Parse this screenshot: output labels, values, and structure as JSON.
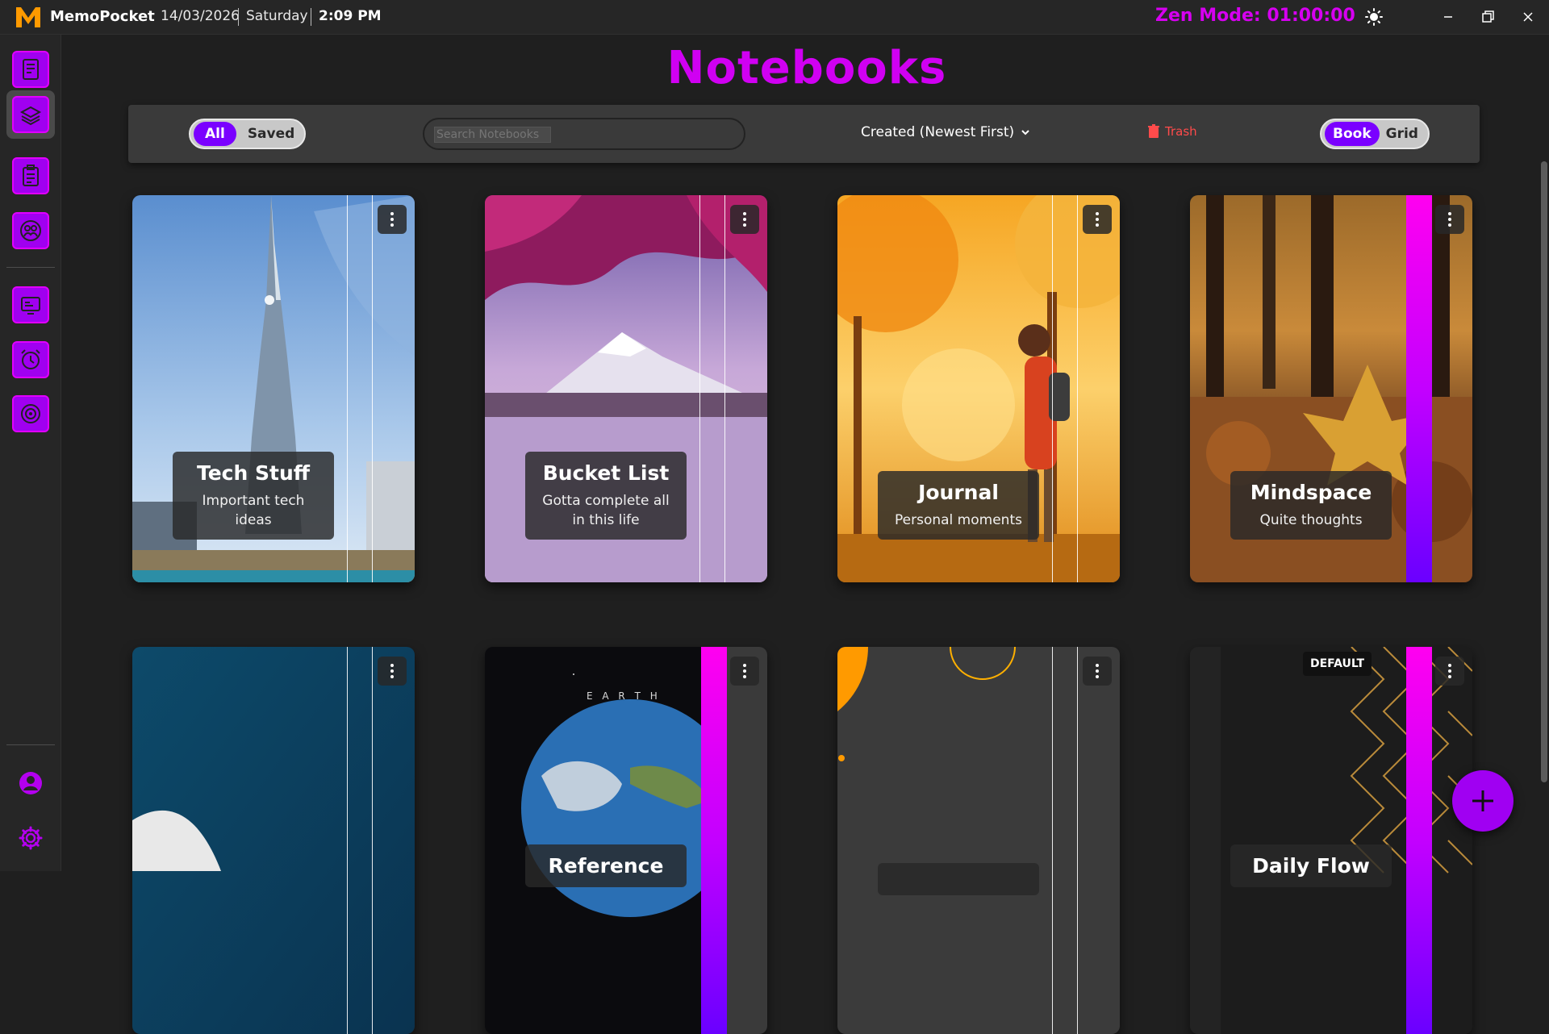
{
  "app": {
    "name": "MemoPocket",
    "date": "14/03/2026",
    "day": "Saturday",
    "time": "2:09 PM",
    "zen_mode": "Zen Mode: 01:00:00"
  },
  "page": {
    "title": "Notebooks"
  },
  "toolbar": {
    "filter_all": "All",
    "filter_saved": "Saved",
    "search_placeholder": "Search Notebooks",
    "sort_label": "Created (Newest First)",
    "trash_label": "Trash",
    "view_book": "Book",
    "view_grid": "Grid"
  },
  "notebooks": [
    {
      "title": "Tech Stuff",
      "description": "Important tech ideas"
    },
    {
      "title": "Bucket List",
      "description": "Gotta complete all in this life"
    },
    {
      "title": "Journal",
      "description": "Personal moments"
    },
    {
      "title": "Mindspace",
      "description": "Quite thoughts"
    },
    {
      "title": "",
      "description": ""
    },
    {
      "title": "Reference",
      "description": "",
      "cover_text": "E A R T H"
    },
    {
      "title": "",
      "description": ""
    },
    {
      "title": "Daily Flow",
      "description": "",
      "badge": "DEFAULT"
    }
  ],
  "colors": {
    "accent": "#a000f2",
    "title": "#d000f2",
    "zen": "#d600f0",
    "danger": "#ff4b4b"
  },
  "icons": {
    "sidebar": [
      "notes-icon",
      "notebooks-icon",
      "tasks-icon",
      "people-icon",
      "board-icon",
      "alarm-icon",
      "goals-icon"
    ],
    "bottom": [
      "profile-icon",
      "settings-icon"
    ]
  }
}
